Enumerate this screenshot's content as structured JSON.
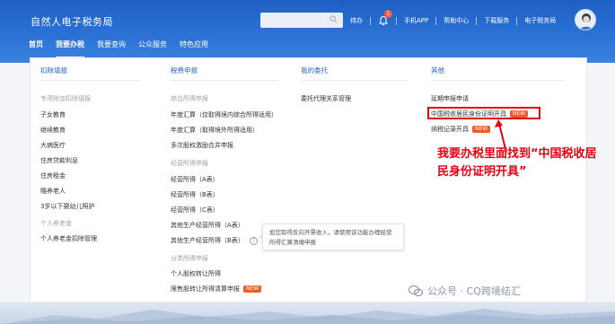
{
  "header": {
    "brand": "自然人电子税务局",
    "links": [
      "待办",
      "手机APP",
      "帮助中心",
      "下载服务",
      "电子税务局"
    ],
    "notification_badge": "1"
  },
  "nav": [
    "首页",
    "我要办税",
    "我要查询",
    "公众服务",
    "特色应用"
  ],
  "columns": {
    "deduction": {
      "title": "扣除填报",
      "group1": "专项附加扣除填报",
      "items": [
        "子女教育",
        "继续教育",
        "大病医疗",
        "住房贷款利息",
        "住房租金",
        "赡养老人",
        "3岁以下婴幼儿照护"
      ],
      "group2": "个人养老金",
      "item2": "个人养老金扣除管理"
    },
    "tax": {
      "title": "税费申报",
      "group1": "综合所得申报",
      "items1": [
        "年度汇算（仅取得境内综合所得适用）",
        "年度汇算（取得境外所得适用）",
        "多次股权激励合并申报"
      ],
      "group2": "经营所得申报",
      "items2": [
        "经营所得（A表）",
        "经营所得（B表）",
        "经营所得（C表）",
        "其他生产经营所得（A表）",
        "其他生产经营所得（B表）"
      ],
      "group3": "分类所得申报",
      "items3": [
        "个人股权转让所得",
        "限售股转让所得清算申报"
      ],
      "new": "NEW"
    },
    "entrust": {
      "title": "我的委托",
      "items": [
        "委托代理关系管理"
      ]
    },
    "other": {
      "title": "其他",
      "items": [
        "延期申报申请",
        "中国税收居民身份证明开具",
        "纳税记录开具"
      ],
      "new": "NEW"
    }
  },
  "tooltip": "如您取得反向开票收入，请使用该功能办理经营所得汇算清缴申报",
  "annotation": "我要办税里面找到“中国税收居民身份证明开具”",
  "watermark": "公众号 · CQ跨境结汇"
}
